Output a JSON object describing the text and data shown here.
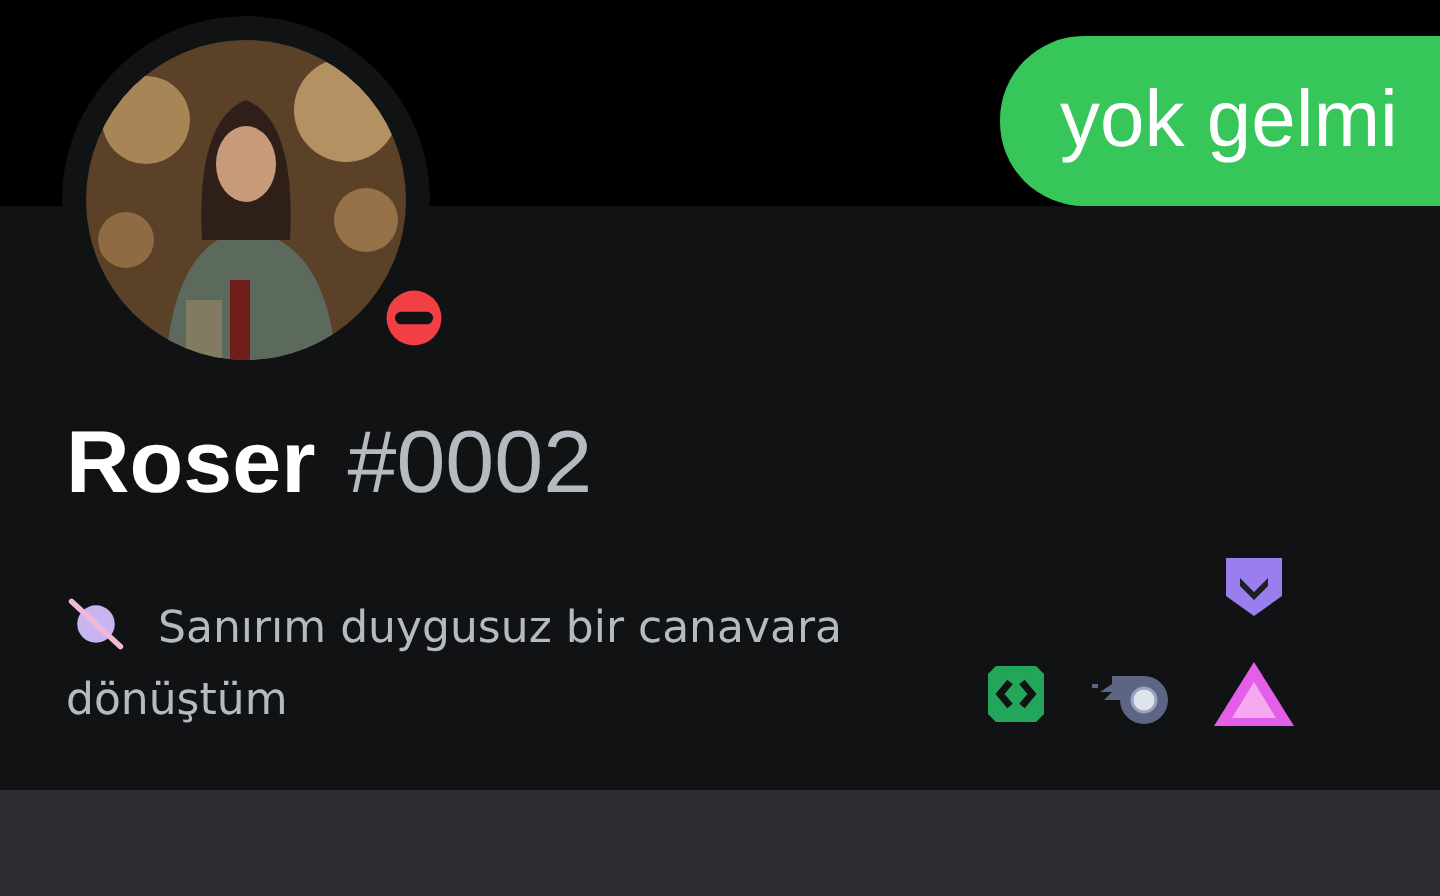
{
  "message_bubble": {
    "text": "yok gelmi"
  },
  "profile": {
    "do_not_disturb": true,
    "username": "Roser",
    "discriminator": "#0002",
    "bio": "Sanırım duygusuz bir canavara dönüştüm"
  }
}
